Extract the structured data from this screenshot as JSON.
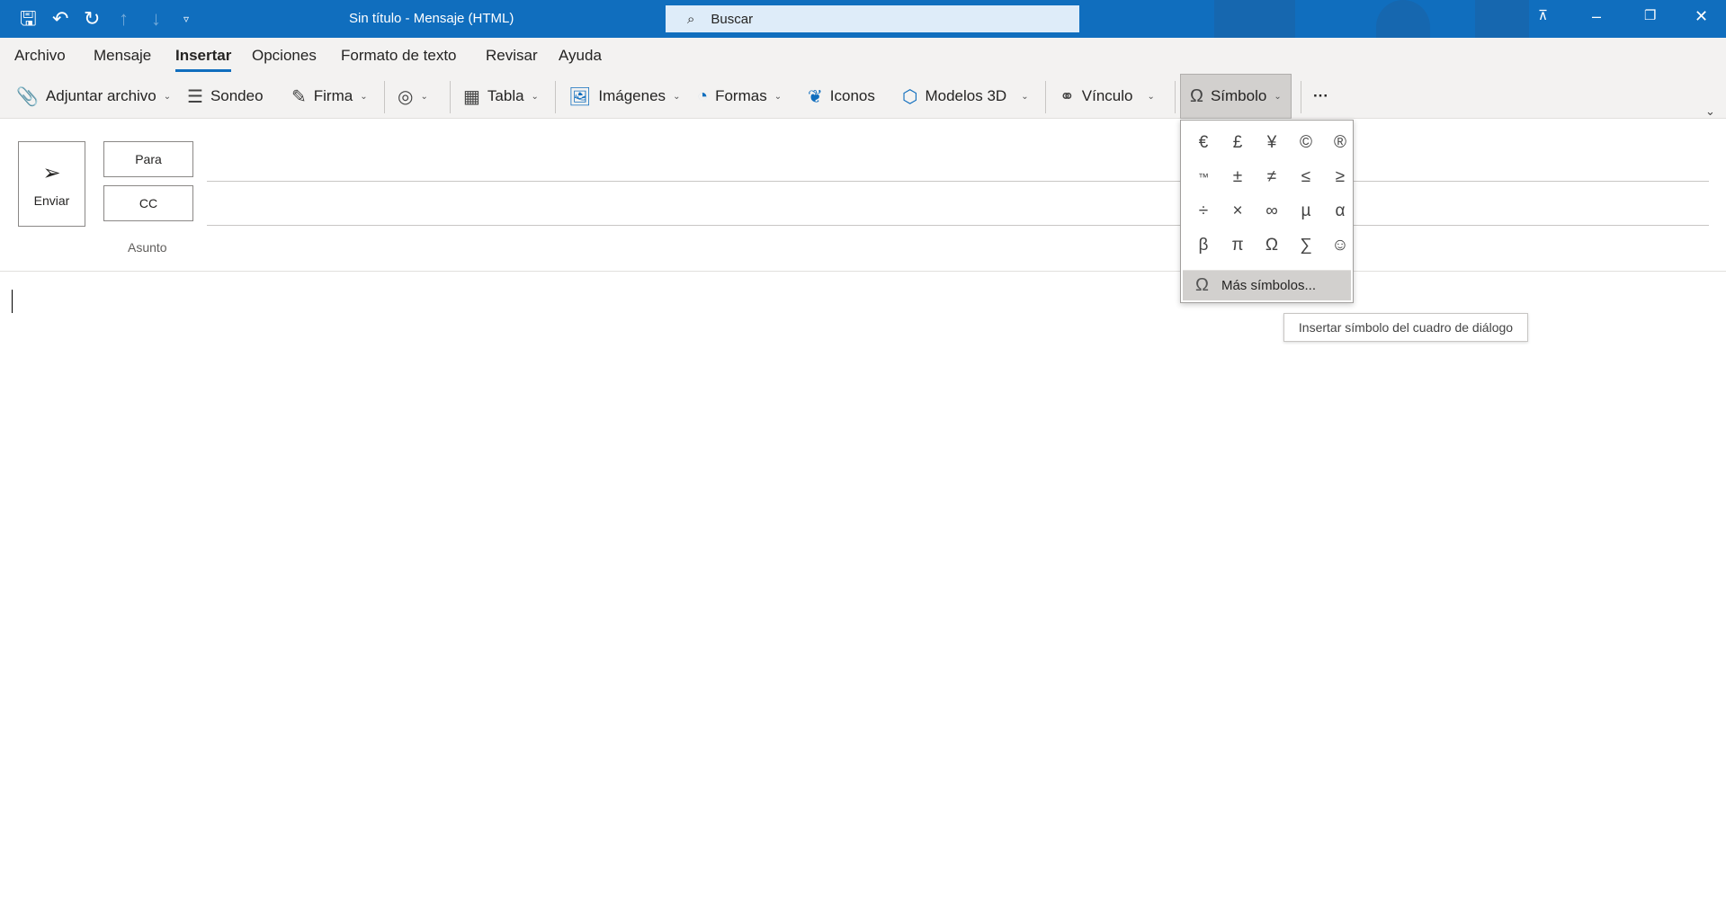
{
  "titlebar": {
    "title": "Sin título  -  Mensaje (HTML)",
    "search_placeholder": "Buscar",
    "accent": "#106ebe"
  },
  "tabs": [
    "Archivo",
    "Mensaje",
    "Insertar",
    "Opciones",
    "Formato de texto",
    "Revisar",
    "Ayuda"
  ],
  "active_tab": "Insertar",
  "ribbon": {
    "attach": "Adjuntar archivo",
    "poll": "Sondeo",
    "signature": "Firma",
    "table": "Tabla",
    "images": "Imágenes",
    "shapes": "Formas",
    "icons": "Iconos",
    "models3d": "Modelos 3D",
    "link": "Vínculo",
    "symbol": "Símbolo",
    "more": "···"
  },
  "compose": {
    "send": "Enviar",
    "to": "Para",
    "cc": "CC",
    "subject": "Asunto"
  },
  "symbol_menu": {
    "symbols": [
      "€",
      "£",
      "¥",
      "©",
      "®",
      "™",
      "±",
      "≠",
      "≤",
      "≥",
      "÷",
      "×",
      "∞",
      "µ",
      "α",
      "β",
      "π",
      "Ω",
      "∑",
      "☺"
    ],
    "more_label": "Más símbolos..."
  },
  "tooltip": "Insertar símbolo del cuadro de diálogo"
}
